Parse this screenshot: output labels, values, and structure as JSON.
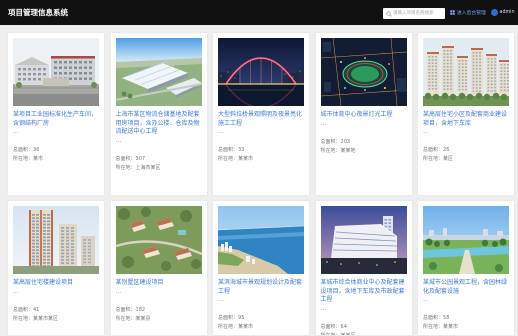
{
  "app": {
    "title": "项目管理信息系统"
  },
  "header": {
    "search": {
      "placeholder": "请输入项目名称搜索",
      "icon": "search-icon"
    },
    "admin_link": {
      "label": "进入后台管理",
      "icon": "dashboard-icon"
    },
    "user": {
      "name": "admin",
      "avatar_icon": "user-avatar-icon"
    }
  },
  "colors": {
    "header_bg": "#111111",
    "page_bg": "#eeeeee",
    "link": "#3c7ad6",
    "meta_text": "#777777"
  },
  "cards": [
    {
      "title": "某项目工业园标准化生产车间，含钢结构厂房",
      "desc": "...",
      "meta": [
        {
          "label": "总面积：",
          "value": "36"
        },
        {
          "label": "所在地：",
          "value": "某市"
        }
      ]
    },
    {
      "title": "上海市某区物流仓储基地及配套用房项目，含办公楼、仓库及物流配送中心工程",
      "desc": "...",
      "meta": [
        {
          "label": "总面积：",
          "value": "307"
        },
        {
          "label": "所在地：",
          "value": "上海市某区"
        }
      ]
    },
    {
      "title": "大型斜拉桥景观照明及夜景亮化施工工程",
      "desc": "...",
      "meta": [
        {
          "label": "总面积：",
          "value": "33"
        },
        {
          "label": "所在地：",
          "value": "某某市"
        }
      ]
    },
    {
      "title": "城市体育中心夜景灯光工程",
      "desc": "...",
      "meta": [
        {
          "label": "总面积：",
          "value": "203"
        },
        {
          "label": "所在地：",
          "value": "某某地"
        }
      ]
    },
    {
      "title": "某高层住宅小区及配套商业建设项目，含地下车库",
      "desc": "...",
      "meta": [
        {
          "label": "总面积：",
          "value": "26"
        },
        {
          "label": "所在地：",
          "value": "某区"
        }
      ]
    },
    {
      "title": "某高层住宅楼建设项目",
      "desc": "...",
      "meta": [
        {
          "label": "总面积：",
          "value": "41"
        },
        {
          "label": "所在地：",
          "value": "某某市某区"
        }
      ]
    },
    {
      "title": "某别墅区建设项目",
      "desc": "...",
      "meta": [
        {
          "label": "总面积：",
          "value": "182"
        },
        {
          "label": "所在地：",
          "value": "某某县"
        }
      ]
    },
    {
      "title": "某滨海城市景观规划设计及配套工程",
      "desc": "...",
      "meta": [
        {
          "label": "总面积：",
          "value": "95"
        },
        {
          "label": "所在地：",
          "value": "某某市"
        }
      ]
    },
    {
      "title": "某城市综合体商业中心及配套建设项目，含地下车库及市政配套工程",
      "desc": "...",
      "meta": [
        {
          "label": "总面积：",
          "value": "64"
        },
        {
          "label": "所在地：",
          "value": "某某区"
        }
      ]
    },
    {
      "title": "某城市公园景观工程，含园林绿化及配套设施",
      "desc": "...",
      "meta": [
        {
          "label": "总面积：",
          "value": "58"
        },
        {
          "label": "所在地：",
          "value": "某某市"
        }
      ]
    }
  ]
}
